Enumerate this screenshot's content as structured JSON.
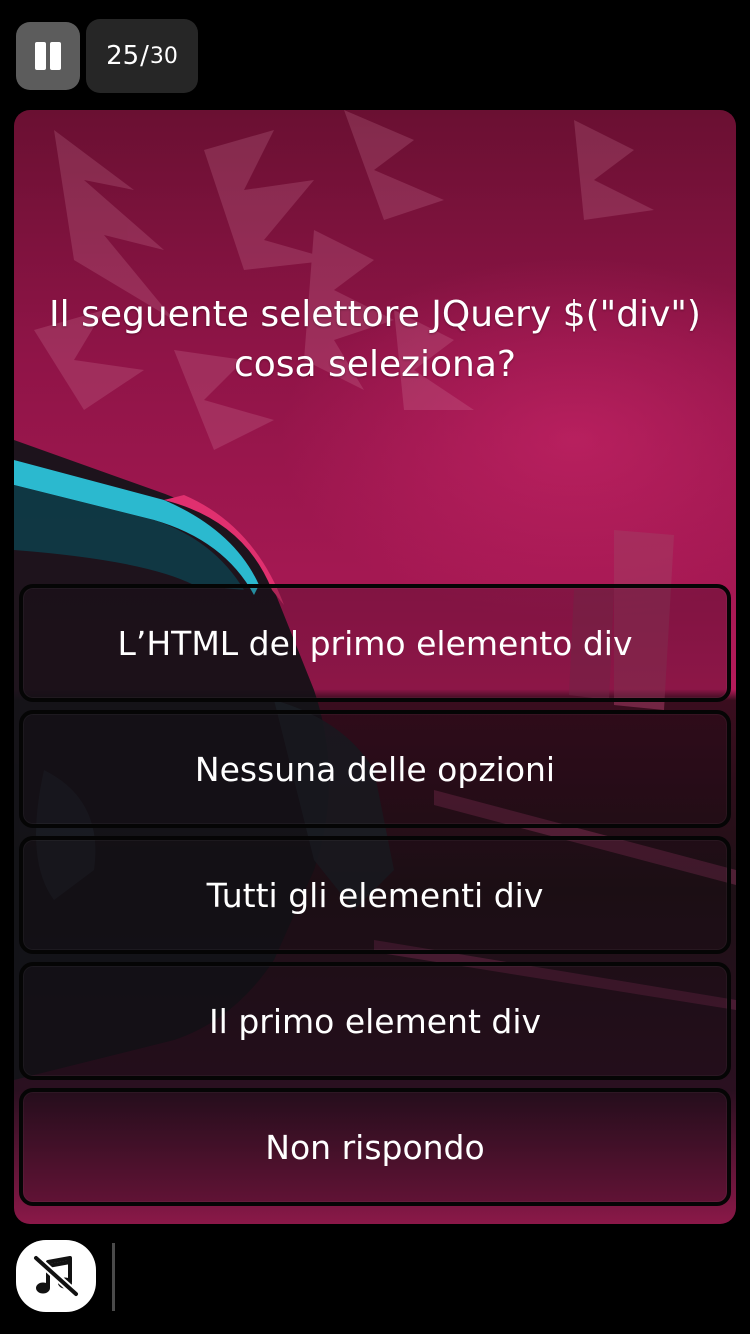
{
  "header": {
    "current": "25",
    "separator": "/",
    "total": "30"
  },
  "question": {
    "line1": "Il seguente selettore JQuery $(\"div\")",
    "line2": "cosa seleziona?"
  },
  "answers": [
    {
      "label": "L’HTML del primo elemento div"
    },
    {
      "label": "Nessuna delle opzioni"
    },
    {
      "label": "Tutti gli elementi div"
    },
    {
      "label": "Il primo element div"
    },
    {
      "label": "Non rispondo"
    }
  ],
  "icons": {
    "pause": "pause-icon",
    "music": "music-off-icon"
  },
  "colors": {
    "accent": "#a41852",
    "background": "#000000"
  }
}
